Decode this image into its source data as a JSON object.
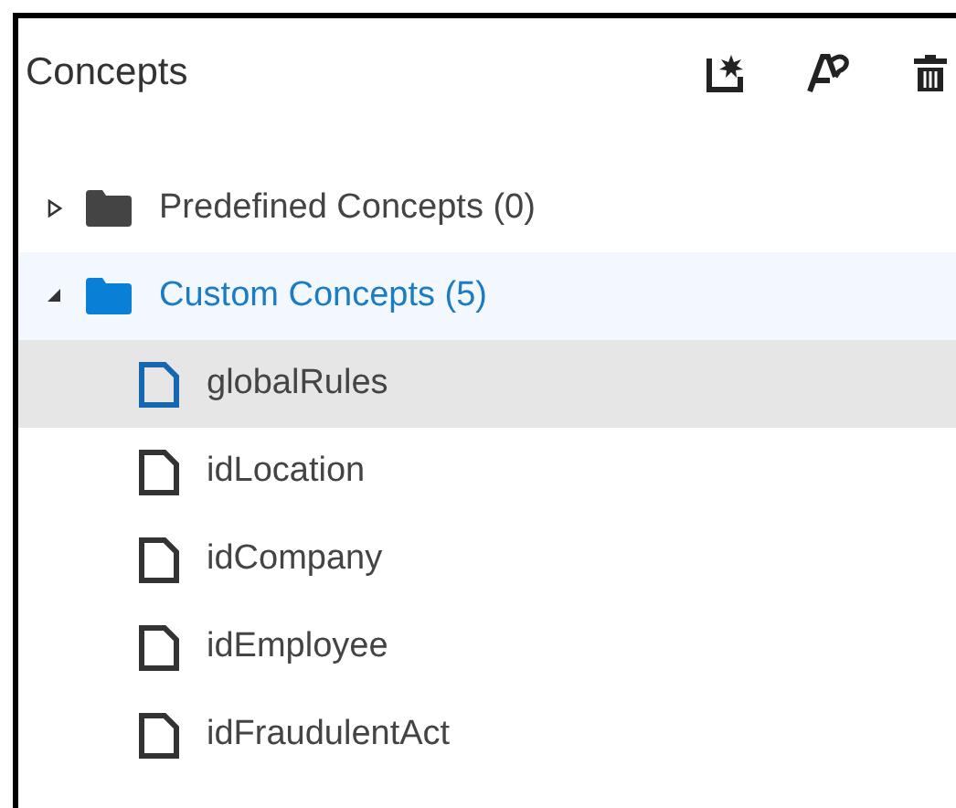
{
  "panel": {
    "title": "Concepts"
  },
  "tree": [
    {
      "label": "Predefined Concepts (0)",
      "expanded": false,
      "selected": false
    },
    {
      "label": "Custom Concepts (5)",
      "expanded": true,
      "selected": true,
      "children": [
        {
          "label": "globalRules",
          "selected": true
        },
        {
          "label": "idLocation",
          "selected": false
        },
        {
          "label": "idCompany",
          "selected": false
        },
        {
          "label": "idEmployee",
          "selected": false
        },
        {
          "label": "idFraudulentAct",
          "selected": false
        }
      ]
    }
  ]
}
